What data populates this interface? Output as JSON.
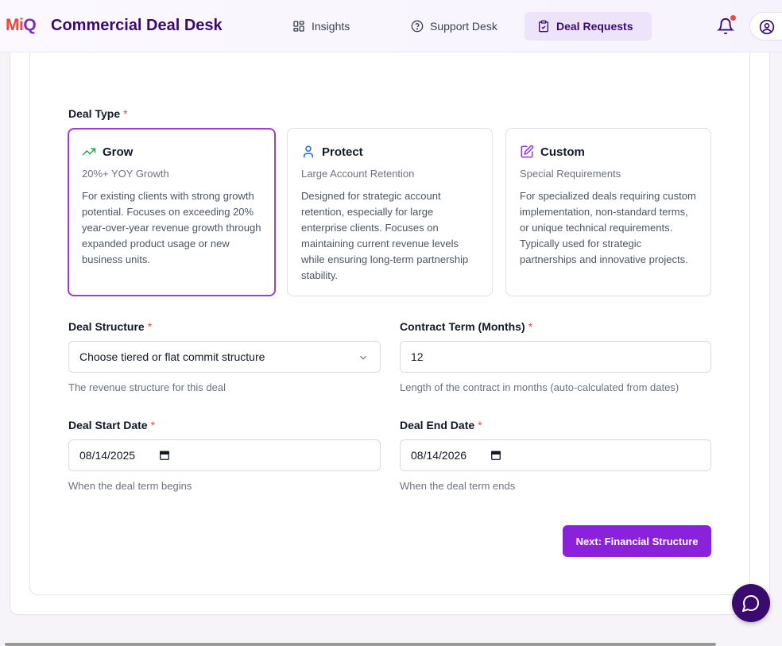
{
  "header": {
    "logo_text_left": "Mi",
    "logo_text_right": "Q",
    "title": "Commercial Deal Desk",
    "nav": [
      {
        "label": "Insights",
        "icon": "grid-icon"
      },
      {
        "label": "Support Desk",
        "icon": "help-circle-icon"
      },
      {
        "label": "Deal Requests",
        "icon": "clipboard-icon",
        "active": true
      }
    ],
    "notification_badge": true
  },
  "form": {
    "deal_type_label": "Deal Type",
    "required_mark": "*",
    "deal_types": [
      {
        "name": "Grow",
        "icon": "trending-up-icon",
        "subtitle": "20%+ YOY Growth",
        "description": "For existing clients with strong growth potential. Focuses on exceeding 20% year-over-year revenue growth through expanded product usage or new business units.",
        "selected": true
      },
      {
        "name": "Protect",
        "icon": "user-icon",
        "subtitle": "Large Account Retention",
        "description": "Designed for strategic account retention, especially for large enterprise clients. Focuses on maintaining current revenue levels while ensuring long-term partnership stability.",
        "selected": false
      },
      {
        "name": "Custom",
        "icon": "edit-icon",
        "subtitle": "Special Requirements",
        "description": "For specialized deals requiring custom implementation, non-standard terms, or unique technical requirements. Typically used for strategic partnerships and innovative projects.",
        "selected": false
      }
    ],
    "deal_structure": {
      "label": "Deal Structure",
      "placeholder": "Choose tiered or flat commit structure",
      "hint": "The revenue structure for this deal"
    },
    "contract_term": {
      "label": "Contract Term (Months)",
      "value": "12",
      "hint": "Length of the contract in months (auto-calculated from dates)"
    },
    "start_date": {
      "label": "Deal Start Date",
      "value": "08/14/2025",
      "hint": "When the deal term begins"
    },
    "end_date": {
      "label": "Deal End Date",
      "value": "08/14/2026",
      "hint": "When the deal term ends"
    },
    "next_button": "Next: Financial Structure"
  },
  "colors": {
    "brand_purple": "#8b22db",
    "dark_purple": "#3b0a6e",
    "selected_border": "#a23ad8",
    "required_red": "#e8483e",
    "grow_icon": "#16a34a",
    "protect_icon": "#2563eb",
    "custom_icon": "#9333ea"
  }
}
